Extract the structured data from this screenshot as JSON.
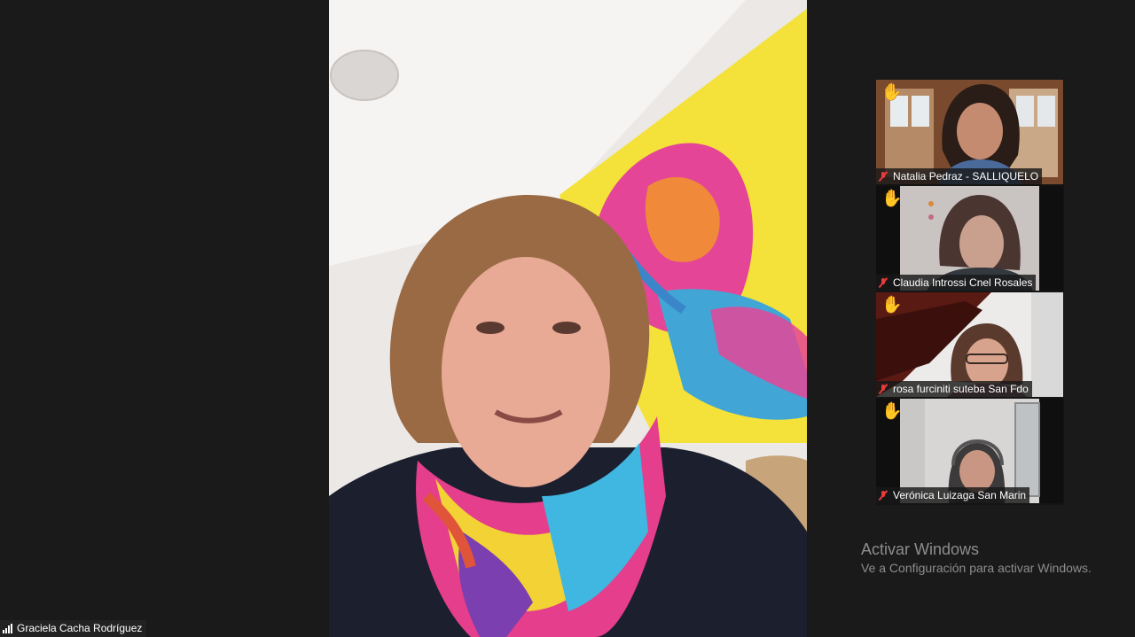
{
  "main_speaker": {
    "name": "Graciela Cacha Rodríguez",
    "icons": {
      "signal": "signal-bars-icon"
    }
  },
  "participants": [
    {
      "name": "Natalia Pedraz -    SALLIQUELO",
      "hand_raised": true,
      "muted": true
    },
    {
      "name": "Claudia Introssi Cnel Rosales",
      "hand_raised": true,
      "muted": true
    },
    {
      "name": "rosa furciniti suteba San Fdo",
      "hand_raised": true,
      "muted": true
    },
    {
      "name": "Verónica Luizaga San Marin",
      "hand_raised": true,
      "muted": true
    }
  ],
  "icons": {
    "hand": "✋",
    "mute": "muted-microphone-icon"
  },
  "windows_watermark": {
    "title": "Activar Windows",
    "subtitle": "Ve a Configuración para activar Windows."
  },
  "colors": {
    "background": "#1a1a1a",
    "hand": "#f7c325",
    "muted": "#e83a3a",
    "watermark_text": "#8d8d8d"
  }
}
